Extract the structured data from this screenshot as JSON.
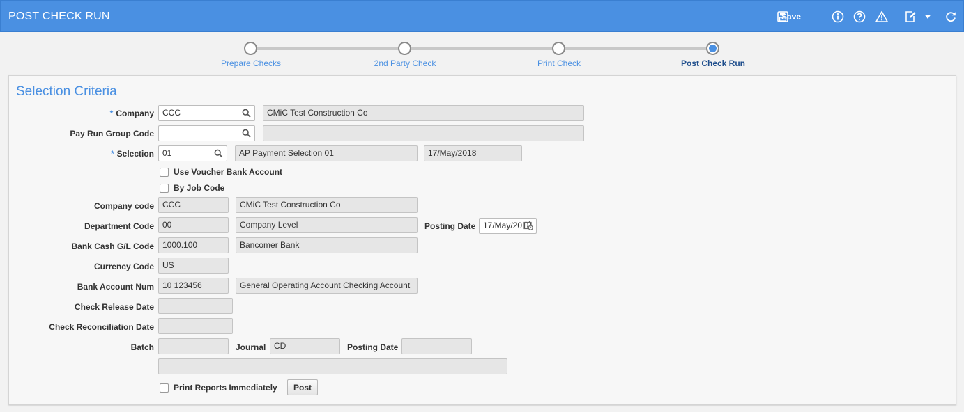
{
  "header": {
    "title": "POST CHECK RUN",
    "save_label": "Save",
    "icons": [
      "save-icon",
      "info-icon",
      "help-icon",
      "warning-icon",
      "edit-icon",
      "chevron-down-icon",
      "refresh-icon"
    ],
    "bg_color": "#4a90e2"
  },
  "wizard": {
    "steps": [
      {
        "label": "Prepare Checks",
        "active": false
      },
      {
        "label": "2nd Party Check",
        "active": false
      },
      {
        "label": "Print Check",
        "active": false
      },
      {
        "label": "Post Check Run",
        "active": true
      }
    ]
  },
  "form": {
    "section_title": "Selection Criteria",
    "required_marker": "*",
    "company": {
      "label": "Company",
      "value": "CCC",
      "description": "CMiC Test Construction Co"
    },
    "pay_run_group": {
      "label": "Pay Run Group Code",
      "value": "",
      "description": ""
    },
    "selection": {
      "label": "Selection",
      "value": "01",
      "description": "AP Payment Selection 01",
      "date": "17/May/2018"
    },
    "use_voucher_bank": {
      "label": "Use Voucher Bank Account",
      "checked": false
    },
    "by_job_code": {
      "label": "By Job Code",
      "checked": false
    },
    "company_code": {
      "label": "Company code",
      "value": "CCC",
      "description": "CMiC Test Construction Co"
    },
    "department_code": {
      "label": "Department Code",
      "value": "00",
      "description": "Company Level"
    },
    "posting_date_top": {
      "label": "Posting Date",
      "value": "17/May/2018"
    },
    "bank_cash_gl": {
      "label": "Bank Cash G/L Code",
      "value": "1000.100",
      "description": "Bancomer Bank"
    },
    "currency_code": {
      "label": "Currency Code",
      "value": "US"
    },
    "bank_account": {
      "label": "Bank Account Num",
      "value": "10 123456",
      "description": "General Operating Account Checking Account"
    },
    "check_release_date": {
      "label": "Check Release Date",
      "value": ""
    },
    "check_reconciliation_date": {
      "label": "Check Reconciliation Date",
      "value": ""
    },
    "batch": {
      "label": "Batch",
      "value": ""
    },
    "journal": {
      "label": "Journal",
      "value": "CD"
    },
    "posting_date_bottom": {
      "label": "Posting Date",
      "value": ""
    },
    "batch_description": {
      "value": ""
    },
    "print_reports": {
      "label": "Print Reports Immediately",
      "checked": false
    },
    "post_button": "Post"
  }
}
